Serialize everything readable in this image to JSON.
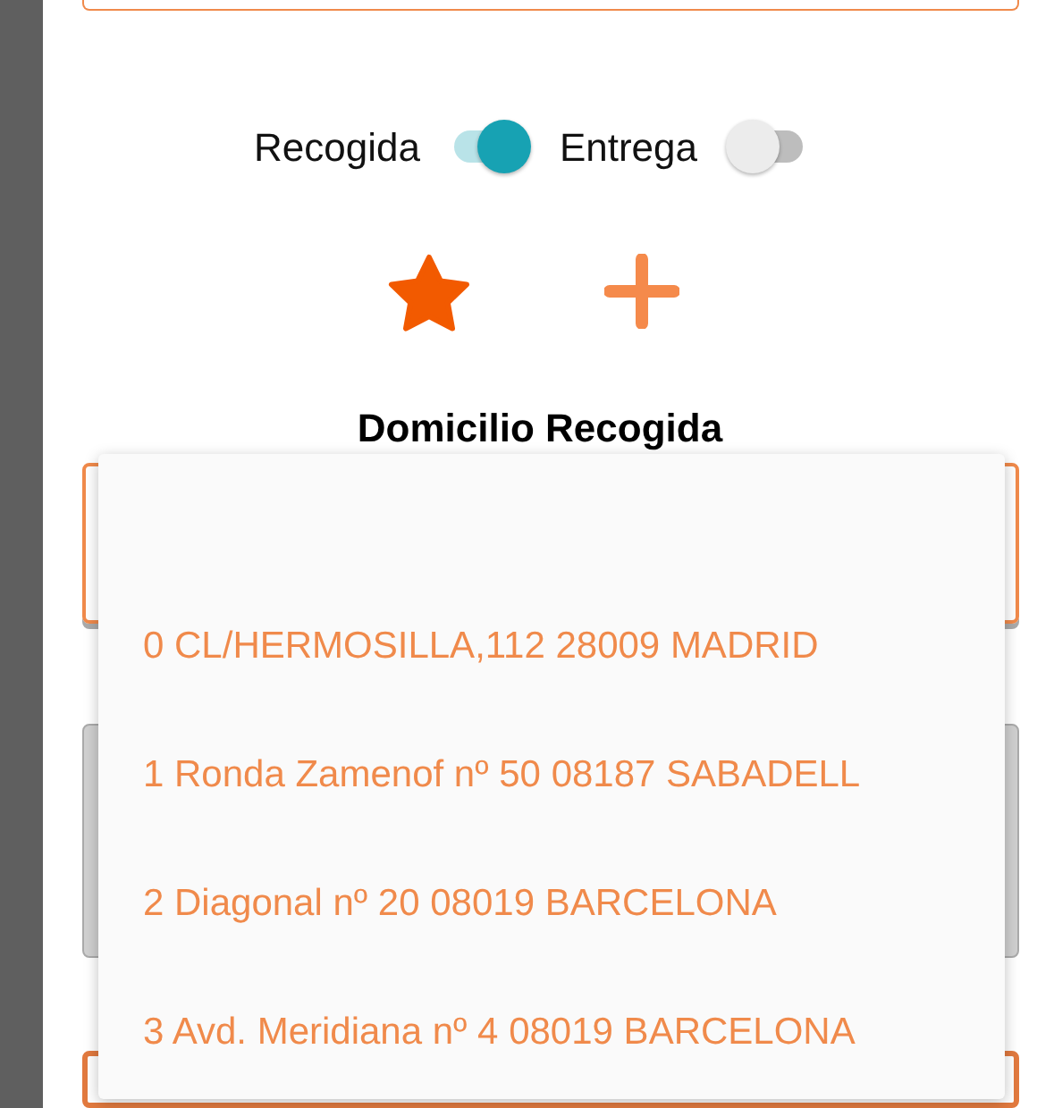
{
  "toggles": [
    {
      "label": "Recogida",
      "on": true
    },
    {
      "label": "Entrega",
      "on": false
    }
  ],
  "heading": "Domicilio Recogida",
  "address_menu": {
    "options": [
      "0 CL/HERMOSILLA,112 28009 MADRID",
      "1 Ronda Zamenof nº 50 08187 SABADELL",
      "2 Diagonal nº 20 08019 BARCELONA",
      "3 Avd. Meridiana nº 4 08019 BARCELONA"
    ]
  }
}
